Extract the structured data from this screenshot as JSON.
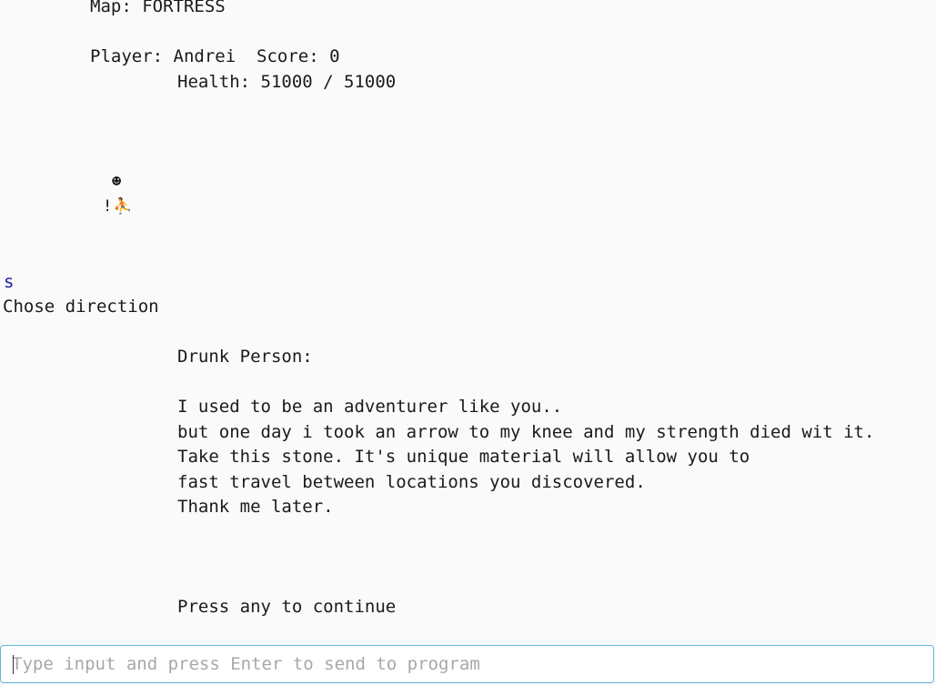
{
  "header": {
    "map_line": "Map: FORTRESS",
    "player_line": "Player: Andrei  Score: 0",
    "health_line": "Health: 51000 / 51000"
  },
  "map_view": {
    "enemy_glyph": "☻",
    "item_glyph": "!",
    "player_glyph": "⛹"
  },
  "console": {
    "echo_input": "s",
    "prompt": "Chose direction"
  },
  "dialog": {
    "speaker": "Drunk Person:",
    "lines": [
      "I used to be an adventurer like you..",
      "but one day i took an arrow to my knee and my strength died wit it.",
      "Take this stone. It's unique material will allow you to",
      "fast travel between locations you discovered.",
      "Thank me later."
    ],
    "continue_prompt": "Press any to continue"
  },
  "input_bar": {
    "placeholder": "Type input and press Enter to send to program",
    "value": ""
  }
}
